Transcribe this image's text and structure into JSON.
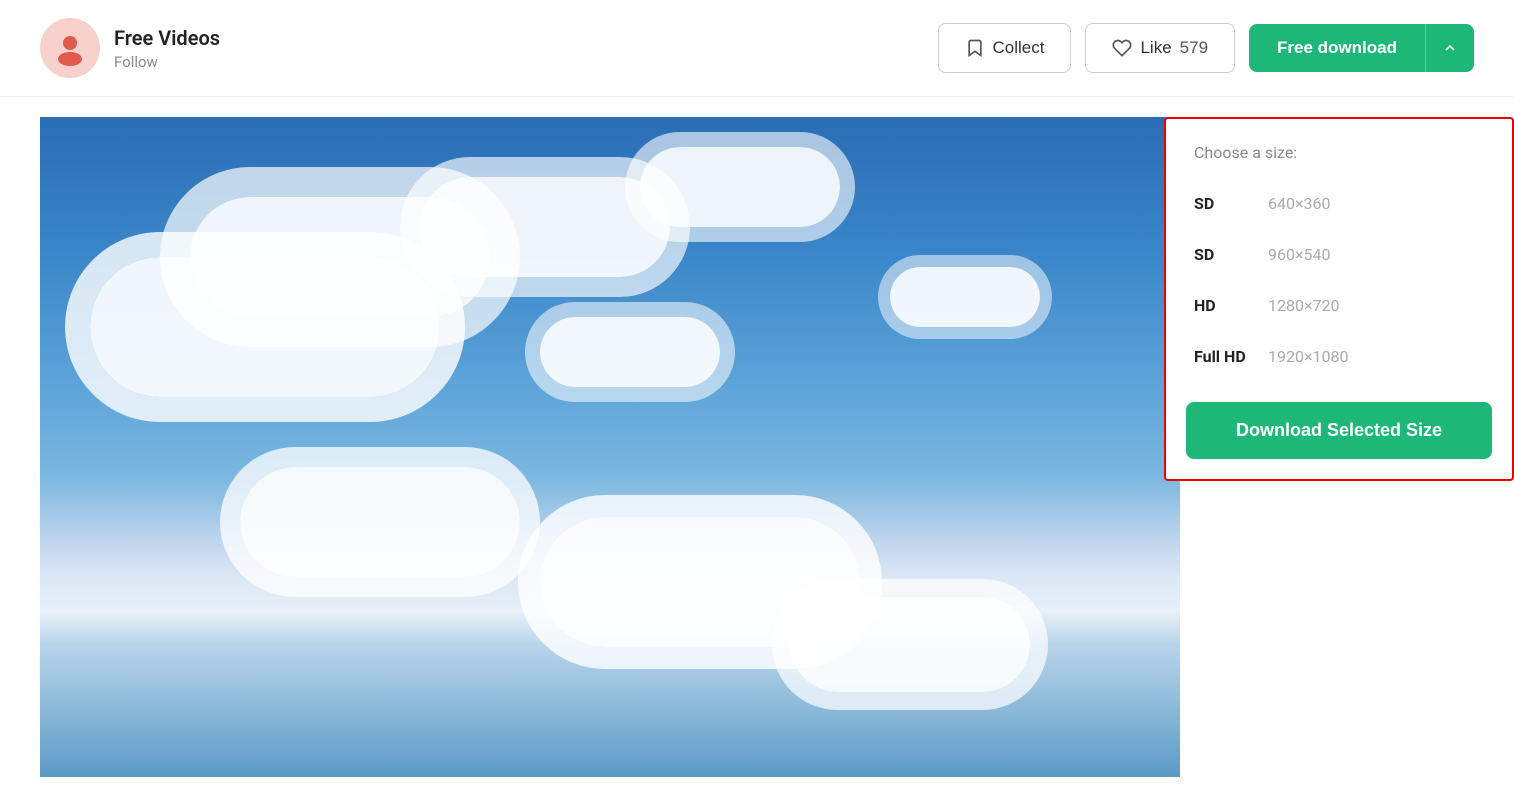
{
  "header": {
    "user_name": "Free Videos",
    "follow_label": "Follow",
    "collect_label": "Collect",
    "like_label": "Like",
    "like_count": "579",
    "free_download_label": "Free download"
  },
  "dropdown": {
    "choose_size_label": "Choose a size:",
    "sizes": [
      {
        "quality": "SD",
        "dims": "640×360"
      },
      {
        "quality": "SD",
        "dims": "960×540"
      },
      {
        "quality": "HD",
        "dims": "1280×720"
      },
      {
        "quality": "Full HD",
        "dims": "1920×1080"
      }
    ],
    "download_button_label": "Download Selected Size"
  }
}
